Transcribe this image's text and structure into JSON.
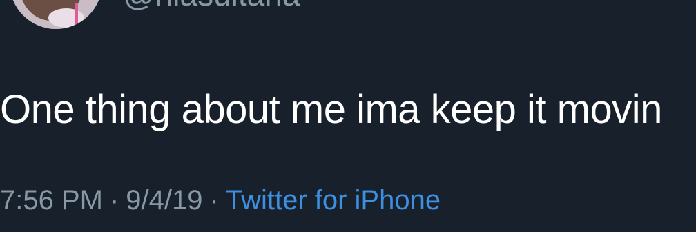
{
  "user": {
    "handle": "@niasultana"
  },
  "tweet": {
    "text": "One thing about me ima keep it movin",
    "time": "7:56 PM",
    "date": "9/4/19",
    "separator": "·",
    "source": "Twitter for iPhone"
  },
  "colors": {
    "background": "#18202b",
    "text": "#ffffff",
    "muted": "#8899a6",
    "link": "#3d8fe0"
  }
}
